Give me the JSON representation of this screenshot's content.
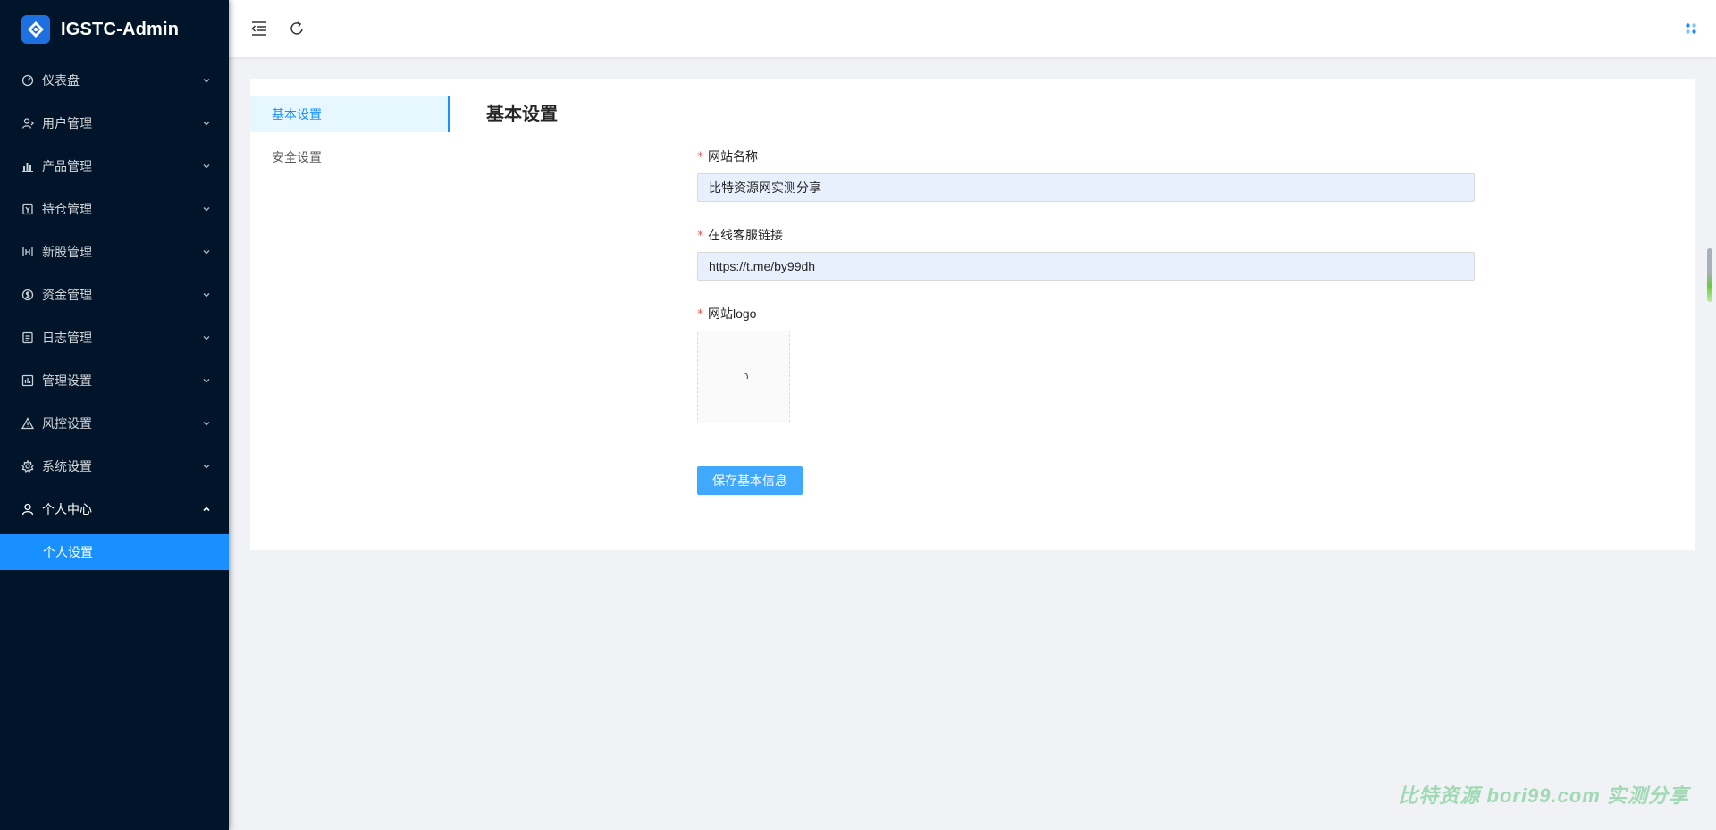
{
  "app": {
    "title": "IGSTC-Admin"
  },
  "sidebar": {
    "items": [
      {
        "label": "仪表盘",
        "icon": "dashboard-icon"
      },
      {
        "label": "用户管理",
        "icon": "user-manage-icon"
      },
      {
        "label": "产品管理",
        "icon": "chart-icon"
      },
      {
        "label": "持仓管理",
        "icon": "position-icon"
      },
      {
        "label": "新股管理",
        "icon": "ipo-icon"
      },
      {
        "label": "资金管理",
        "icon": "money-icon"
      },
      {
        "label": "日志管理",
        "icon": "log-icon"
      },
      {
        "label": "管理设置",
        "icon": "admin-settings-icon"
      },
      {
        "label": "风控设置",
        "icon": "warning-icon"
      },
      {
        "label": "系统设置",
        "icon": "gear-icon"
      },
      {
        "label": "个人中心",
        "icon": "user-icon"
      }
    ],
    "sub_items": [
      {
        "label": "个人设置"
      }
    ]
  },
  "tabs": [
    {
      "label": "基本设置"
    },
    {
      "label": "安全设置"
    }
  ],
  "panel": {
    "title": "基本设置",
    "fields": [
      {
        "label": "网站名称",
        "value": "比特资源网实测分享"
      },
      {
        "label": "在线客服链接",
        "value": "https://t.me/by99dh"
      },
      {
        "label": "网站logo"
      }
    ],
    "save_label": "保存基本信息"
  },
  "watermark": "比特资源  bori99.com  实测分享",
  "colors": {
    "sidebar_bg": "#001529",
    "primary": "#1890ff",
    "button": "#40a9ff"
  }
}
